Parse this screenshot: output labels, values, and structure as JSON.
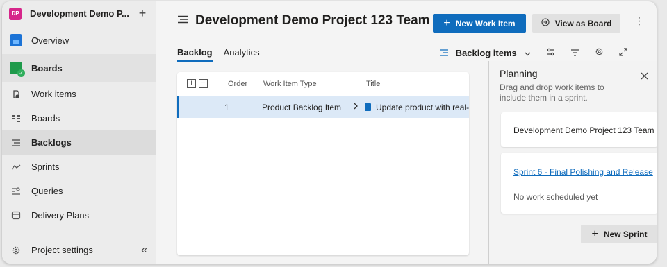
{
  "sidebar": {
    "project_initials": "DP",
    "project_name": "Development Demo P...",
    "add_label": "+",
    "items": [
      {
        "label": "Overview",
        "icon": "overview-icon"
      },
      {
        "label": "Boards",
        "icon": "boards-icon"
      },
      {
        "label": "Work items",
        "icon": "work-items-icon"
      },
      {
        "label": "Boards",
        "icon": "kanban-icon"
      },
      {
        "label": "Backlogs",
        "icon": "backlog-icon"
      },
      {
        "label": "Sprints",
        "icon": "sprints-icon"
      },
      {
        "label": "Queries",
        "icon": "queries-icon"
      },
      {
        "label": "Delivery Plans",
        "icon": "delivery-plans-icon"
      }
    ],
    "project_settings": "Project settings",
    "collapse_glyph": "«"
  },
  "header": {
    "title": "Development Demo Project 123 Team",
    "new_work_item": "New Work Item",
    "view_as_board": "View as Board"
  },
  "tabs": [
    {
      "label": "Backlog",
      "active": true
    },
    {
      "label": "Analytics",
      "active": false
    }
  ],
  "toolbar": {
    "backlog_items": "Backlog items"
  },
  "grid": {
    "columns": [
      "Order",
      "Work Item Type",
      "Title"
    ],
    "rows": [
      {
        "order": "1",
        "type": "Product Backlog Item",
        "title": "Update product with real-"
      }
    ]
  },
  "planning": {
    "title": "Planning",
    "subtitle": "Drag and drop work items to include them in a sprint.",
    "team_card": "Development Demo Project 123 Team",
    "sprint_link": "Sprint 6 - Final Polishing and Release",
    "no_work": "No work scheduled yet",
    "new_sprint": "New Sprint"
  },
  "colors": {
    "accent": "#0f6cbd",
    "selected_row": "#dce9f7",
    "project_badge": "#d6268a"
  }
}
